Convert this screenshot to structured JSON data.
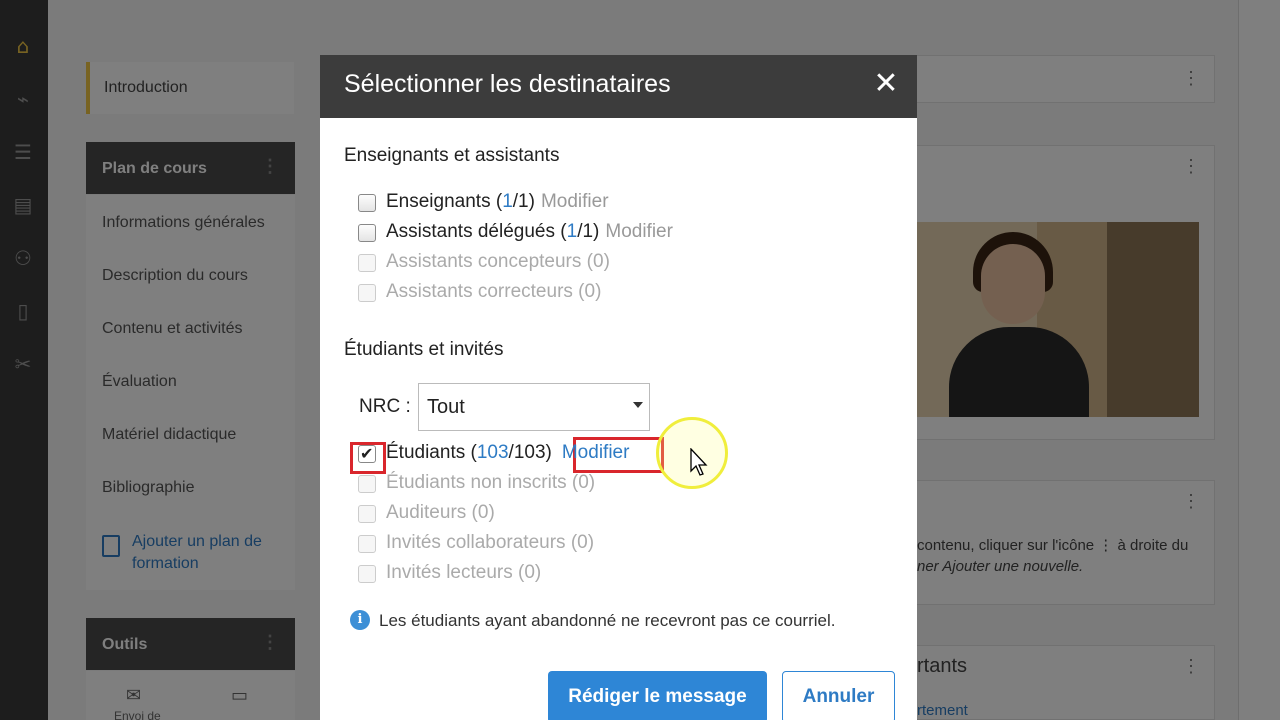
{
  "background": {
    "intro": "Introduction",
    "plan_header": "Plan de cours",
    "nav_items": [
      "Informations générales",
      "Description du cours",
      "Contenu et activités",
      "Évaluation",
      "Matériel didactique",
      "Bibliographie"
    ],
    "add_plan": "Ajouter un plan de formation",
    "tools_header": "Outils",
    "tool_email": "Envoi de",
    "right_text_1": "contenu, cliquer sur l'icône ⋮ à droite du",
    "right_text_2": "ner Ajouter une nouvelle.",
    "right_heading": "rtants",
    "right_link": "rtement"
  },
  "dialog": {
    "title": "Sélectionner les destinataires",
    "close": "✕",
    "group1": {
      "title": "Enseignants et assistants",
      "rows": [
        {
          "label": "Enseignants",
          "open": " (",
          "count": "1",
          "total": "/1)",
          "modifier": "Modifier",
          "checked": false,
          "disabled": false
        },
        {
          "label": "Assistants délégués",
          "open": " (",
          "count": "1",
          "total": "/1)",
          "modifier": "Modifier",
          "checked": false,
          "disabled": false
        },
        {
          "label": "Assistants concepteurs",
          "open": " (",
          "count": "0",
          "total": ")",
          "modifier": "",
          "checked": false,
          "disabled": true
        },
        {
          "label": "Assistants correcteurs",
          "open": " (",
          "count": "0",
          "total": ")",
          "modifier": "",
          "checked": false,
          "disabled": true
        }
      ]
    },
    "group2": {
      "title": "Étudiants et invités",
      "nrc_label": "NRC :",
      "nrc_value": "Tout",
      "rows": [
        {
          "label": "Étudiants",
          "open": " (",
          "count": "103",
          "total": "/103)",
          "modifier": "Modifier",
          "checked": true,
          "disabled": false
        },
        {
          "label": "Étudiants non inscrits",
          "open": " (",
          "count": "0",
          "total": ")",
          "modifier": "",
          "checked": false,
          "disabled": true
        },
        {
          "label": "Auditeurs",
          "open": " (",
          "count": "0",
          "total": ")",
          "modifier": "",
          "checked": false,
          "disabled": true
        },
        {
          "label": "Invités collaborateurs",
          "open": " (",
          "count": "0",
          "total": ")",
          "modifier": "",
          "checked": false,
          "disabled": true
        },
        {
          "label": "Invités lecteurs",
          "open": " (",
          "count": "0",
          "total": ")",
          "modifier": "",
          "checked": false,
          "disabled": true
        }
      ]
    },
    "info_text": "Les étudiants ayant abandonné ne recevront pas ce courriel.",
    "primary_button": "Rédiger le message",
    "secondary_button": "Annuler"
  },
  "colors": {
    "accent_blue": "#2e86d6",
    "highlight_red": "#d9262c",
    "header_dark": "#3c3c3c"
  }
}
